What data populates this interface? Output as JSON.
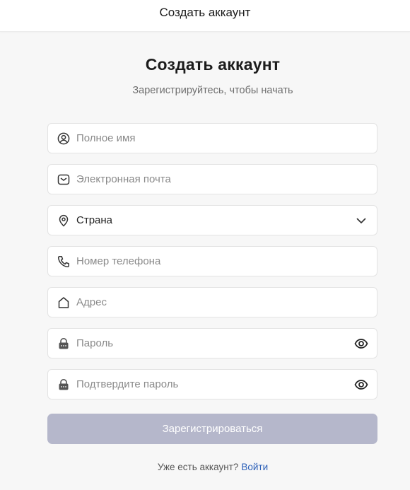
{
  "header": {
    "title": "Создать аккаунт"
  },
  "form": {
    "title": "Создать аккаунт",
    "subtitle": "Зарегистрируйтесь, чтобы начать",
    "fields": {
      "full_name": {
        "placeholder": "Полное имя",
        "value": "",
        "icon": "user-circle-icon"
      },
      "email": {
        "placeholder": "Электронная почта",
        "value": "",
        "icon": "mail-icon"
      },
      "country": {
        "value": "Страна",
        "icon": "location-pin-icon",
        "trailing_icon": "chevron-down-icon"
      },
      "phone": {
        "placeholder": "Номер телефона",
        "value": "",
        "icon": "phone-icon"
      },
      "address": {
        "placeholder": "Адрес",
        "value": "",
        "icon": "home-icon"
      },
      "password": {
        "placeholder": "Пароль",
        "value": "",
        "icon": "lock-icon",
        "trailing_icon": "eye-icon"
      },
      "confirm_password": {
        "placeholder": "Подтвердите пароль",
        "value": "",
        "icon": "lock-icon",
        "trailing_icon": "eye-icon"
      }
    },
    "submit_label": "Зарегистрироваться"
  },
  "footer": {
    "prompt": "Уже есть аккаунт?",
    "link": "Войти"
  },
  "colors": {
    "background": "#f7f7f7",
    "button_disabled": "#b5b7cb",
    "link": "#2b5fb8",
    "icon": "#333333"
  }
}
